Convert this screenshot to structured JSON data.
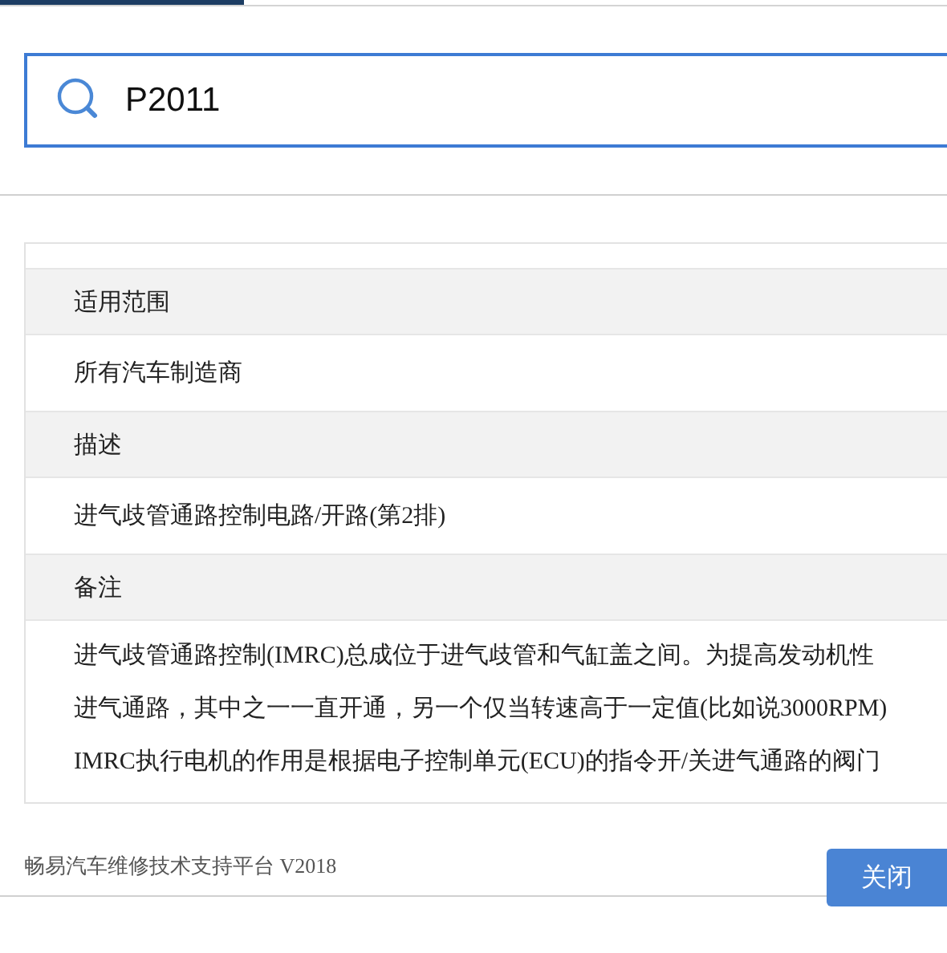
{
  "search": {
    "value": "P2011"
  },
  "sections": [
    {
      "heading": "适用范围",
      "lines": [
        "所有汽车制造商"
      ]
    },
    {
      "heading": "描述",
      "lines": [
        "进气歧管通路控制电路/开路(第2排)"
      ]
    },
    {
      "heading": "备注",
      "lines": [
        "进气歧管通路控制(IMRC)总成位于进气歧管和气缸盖之间。为提高发动机性",
        "进气通路，其中之一一直开通，另一个仅当转速高于一定值(比如说3000RPM)",
        "IMRC执行电机的作用是根据电子控制单元(ECU)的指令开/关进气通路的阀门"
      ]
    }
  ],
  "footer": {
    "text": "畅易汽车维修技术支持平台 V2018",
    "button": "关闭"
  }
}
